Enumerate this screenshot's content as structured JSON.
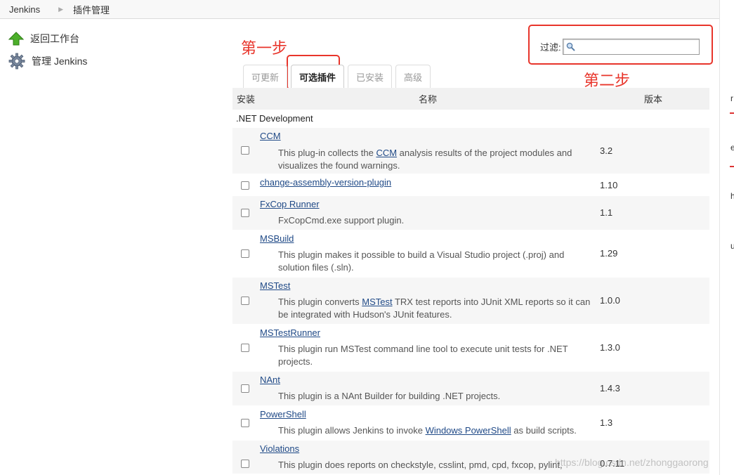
{
  "breadcrumb": {
    "root": "Jenkins",
    "current": "插件管理"
  },
  "sidebar": {
    "items": [
      {
        "label": "返回工作台",
        "icon": "up-arrow-icon"
      },
      {
        "label": "管理 Jenkins",
        "icon": "gear-icon"
      }
    ]
  },
  "annotations": {
    "step1": "第一步",
    "step2": "第二步"
  },
  "filter": {
    "label": "过滤:",
    "value": ""
  },
  "tabs": [
    {
      "label": "可更新",
      "active": false
    },
    {
      "label": "可选插件",
      "active": true
    },
    {
      "label": "已安装",
      "active": false
    },
    {
      "label": "高级",
      "active": false
    }
  ],
  "table": {
    "headers": {
      "install": "安装",
      "name": "名称",
      "version": "版本"
    },
    "category": ".NET Development",
    "plugins": [
      {
        "name": "CCM",
        "desc_pre": "This plug-in collects the ",
        "desc_link": "CCM",
        "desc_post": " analysis results of the project modules and visualizes the found warnings.",
        "version": "3.2"
      },
      {
        "name": "change-assembly-version-plugin",
        "desc_pre": "",
        "desc_link": "",
        "desc_post": "",
        "version": "1.10"
      },
      {
        "name": "FxCop Runner",
        "desc_pre": "FxCopCmd.exe support plugin.",
        "desc_link": "",
        "desc_post": "",
        "version": "1.1"
      },
      {
        "name": "MSBuild",
        "desc_pre": "This plugin makes it possible to build a Visual Studio project (.proj) and solution files (.sln).",
        "desc_link": "",
        "desc_post": "",
        "version": "1.29"
      },
      {
        "name": "MSTest",
        "desc_pre": "This plugin converts ",
        "desc_link": "MSTest",
        "desc_post": " TRX test reports into JUnit XML reports so it can be integrated with Hudson's JUnit features.",
        "version": "1.0.0"
      },
      {
        "name": "MSTestRunner",
        "desc_pre": "This plugin run MSTest command line tool to execute unit tests for .NET projects.",
        "desc_link": "",
        "desc_post": "",
        "version": "1.3.0"
      },
      {
        "name": "NAnt",
        "desc_pre": "This plugin is a NAnt Builder for building .NET projects.",
        "desc_link": "",
        "desc_post": "",
        "version": "1.4.3"
      },
      {
        "name": "PowerShell",
        "desc_pre": "This plugin allows Jenkins to invoke ",
        "desc_link": "Windows PowerShell",
        "desc_post": " as build scripts.",
        "version": "1.3"
      },
      {
        "name": "Violations",
        "desc_pre": "This plugin does reports on checkstyle, csslint, pmd, cpd, fxcop, pylint,",
        "desc_link": "",
        "desc_post": "",
        "version": "0.7.11"
      }
    ]
  },
  "watermark": "https://blog.csdn.net/zhonggaorong",
  "colors": {
    "annotation": "#e8352b",
    "link": "#204a87",
    "header_bg": "#f1f1f1"
  }
}
